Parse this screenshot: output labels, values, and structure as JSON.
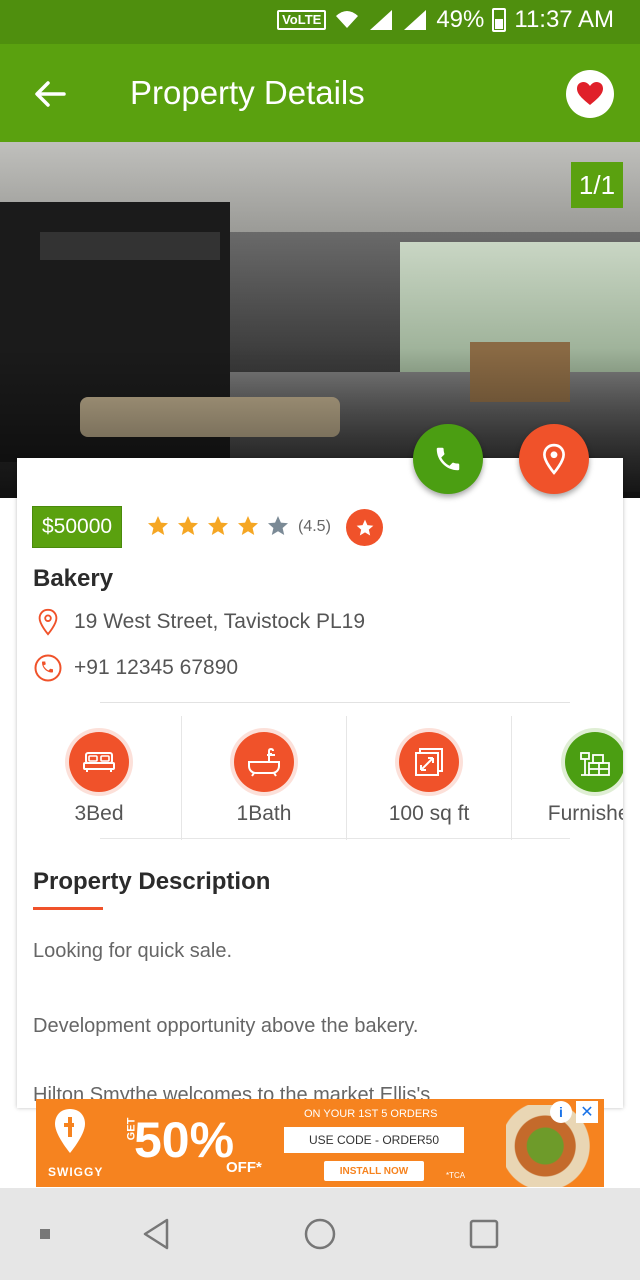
{
  "status_bar": {
    "network": "VoLTE",
    "battery": "49%",
    "time": "11:37 AM"
  },
  "app_bar": {
    "title": "Property Details"
  },
  "gallery": {
    "counter": "1/1"
  },
  "property": {
    "price": "$50000",
    "rating_value": 4.5,
    "rating_label": "(4.5)",
    "name": "Bakery",
    "address": "19 West Street, Tavistock PL19",
    "phone": "+91 12345 67890"
  },
  "features": [
    {
      "label": "3Bed",
      "icon": "bed-icon",
      "color": "#f0522a"
    },
    {
      "label": "1Bath",
      "icon": "bathtub-icon",
      "color": "#f0522a"
    },
    {
      "label": "100 sq ft",
      "icon": "area-icon",
      "color": "#f0522a"
    },
    {
      "label": "Furnished",
      "icon": "furniture-icon",
      "color": "#4b9e12"
    }
  ],
  "description": {
    "heading": "Property Description",
    "paragraphs": [
      "Looking for quick sale.",
      "Development opportunity above the bakery.",
      "Hilton Smythe welcomes to the market Ellis's"
    ]
  },
  "ad": {
    "brand": "SWIGGY",
    "get": "GET",
    "percent": "50%",
    "off": "OFF*",
    "orders_line": "ON YOUR 1ST 5 ORDERS",
    "code_label": "USE CODE - ORDER50",
    "install": "INSTALL NOW",
    "tca": "*TCA"
  },
  "colors": {
    "primary": "#5aa10f",
    "accent": "#f0522a"
  }
}
